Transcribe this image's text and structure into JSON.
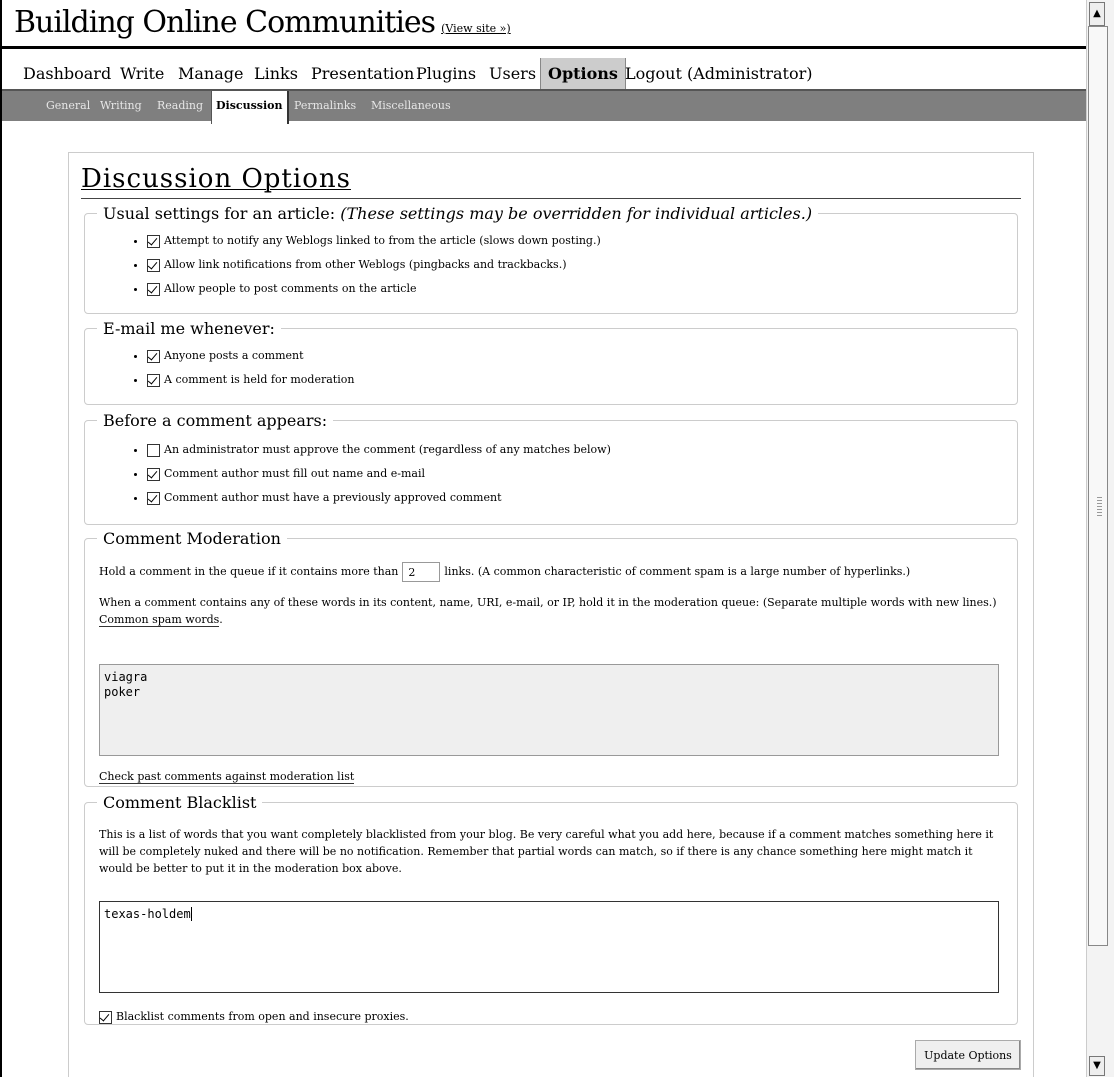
{
  "header": {
    "site_title": "Building Online Communities",
    "view_site": "(View site »)"
  },
  "main_nav": [
    "Dashboard",
    "Write",
    "Manage",
    "Links",
    "Presentation",
    "Plugins",
    "Users",
    "Options",
    "Logout (Administrator)"
  ],
  "main_nav_active": "Options",
  "sub_nav": [
    "General",
    "Writing",
    "Reading",
    "Discussion",
    "Permalinks",
    "Miscellaneous"
  ],
  "sub_nav_active": "Discussion",
  "page_title": "Discussion Options",
  "usual": {
    "legend": "Usual settings for an article:",
    "legend_note": "(These settings may be overridden for individual articles.)",
    "options": [
      {
        "label": "Attempt to notify any Weblogs linked to from the article (slows down posting.)",
        "checked": true
      },
      {
        "label": "Allow link notifications from other Weblogs (pingbacks and trackbacks.)",
        "checked": true
      },
      {
        "label": "Allow people to post comments on the article",
        "checked": true
      }
    ]
  },
  "email": {
    "legend": "E-mail me whenever:",
    "options": [
      {
        "label": "Anyone posts a comment",
        "checked": true
      },
      {
        "label": "A comment is held for moderation",
        "checked": true
      }
    ]
  },
  "before": {
    "legend": "Before a comment appears:",
    "options": [
      {
        "label": "An administrator must approve the comment (regardless of any matches below)",
        "checked": false
      },
      {
        "label": "Comment author must fill out name and e-mail",
        "checked": true
      },
      {
        "label": "Comment author must have a previously approved comment",
        "checked": true
      }
    ]
  },
  "moderation": {
    "legend": "Comment Moderation",
    "hold_prefix": "Hold a comment in the queue if it contains more than",
    "links_value": "2",
    "hold_suffix": "links. (A common characteristic of comment spam is a large number of hyperlinks.)",
    "words_text": "When a comment contains any of these words in its content, name, URI, e-mail, or IP, hold it in the moderation queue: (Separate multiple words with new lines.)",
    "words_link": "Common spam words",
    "words_value": "viagra\npoker",
    "check_link": "Check past comments against moderation list"
  },
  "blacklist": {
    "legend": "Comment Blacklist",
    "text": "This is a list of words that you want completely blacklisted from your blog. Be very careful what you add here, because if a comment matches something here it will be completely nuked and there will be no notification. Remember that partial words can match, so if there is any chance something here might match it would be better to put it in the moderation box above.",
    "value": "texas-holdem",
    "proxy_label": "Blacklist comments from open and insecure proxies.",
    "proxy_checked": true
  },
  "update_button": "Update Options",
  "scrollbar": {
    "up_icon": "arrow-up",
    "down_icon": "arrow-down"
  }
}
